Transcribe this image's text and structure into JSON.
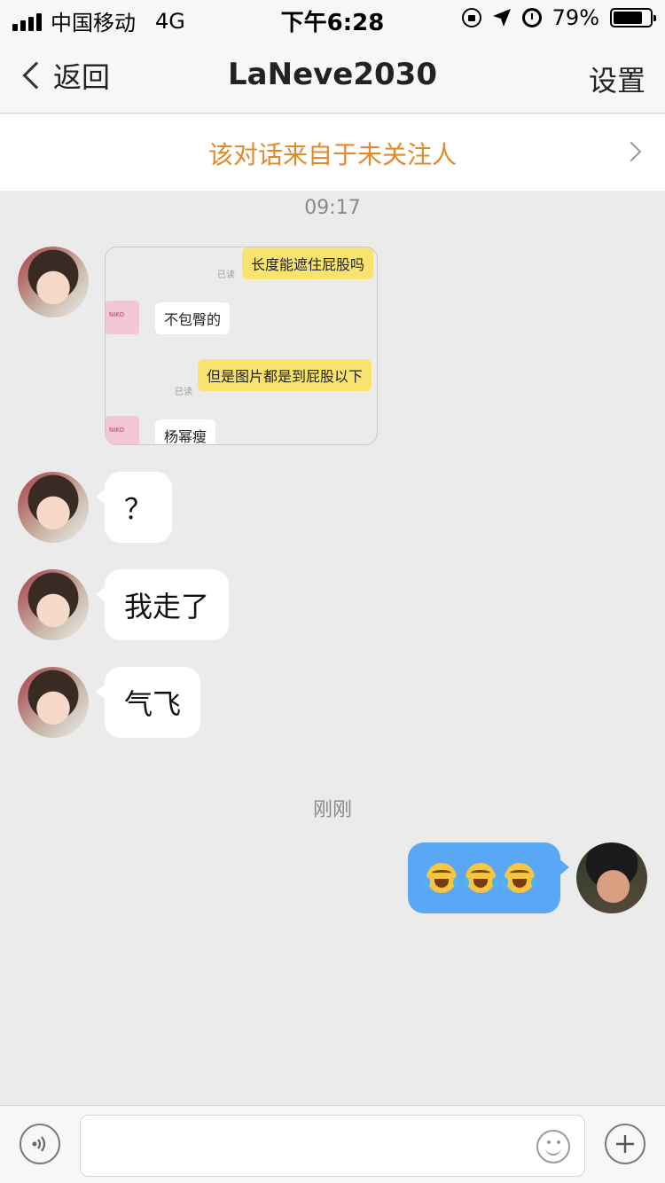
{
  "status_bar": {
    "carrier": "中国移动",
    "network": "4G",
    "time": "下午6:28",
    "battery_percent": "79%",
    "battery_level": 0.79
  },
  "nav": {
    "back_label": "返回",
    "title": "LaNeve2030",
    "settings_label": "设置"
  },
  "banner": {
    "text": "该对话来自于未关注人"
  },
  "timestamps": {
    "first": "09:17",
    "second": "刚刚"
  },
  "image_message": {
    "read_label": "已读",
    "lines": [
      "长度能遮住屁股吗",
      "不包臀的",
      "但是图片都是到屁股以下",
      "杨幂瘦"
    ]
  },
  "messages": {
    "m1": "？",
    "m2": "我走了",
    "m3": "气飞"
  },
  "colors": {
    "banner_text": "#e08a2a",
    "out_bubble": "#5aa7f5",
    "background": "#ebebeb"
  },
  "icons": {
    "voice": "voice-icon",
    "emoji": "smiley-icon",
    "plus": "plus-icon"
  },
  "input": {
    "placeholder": ""
  }
}
